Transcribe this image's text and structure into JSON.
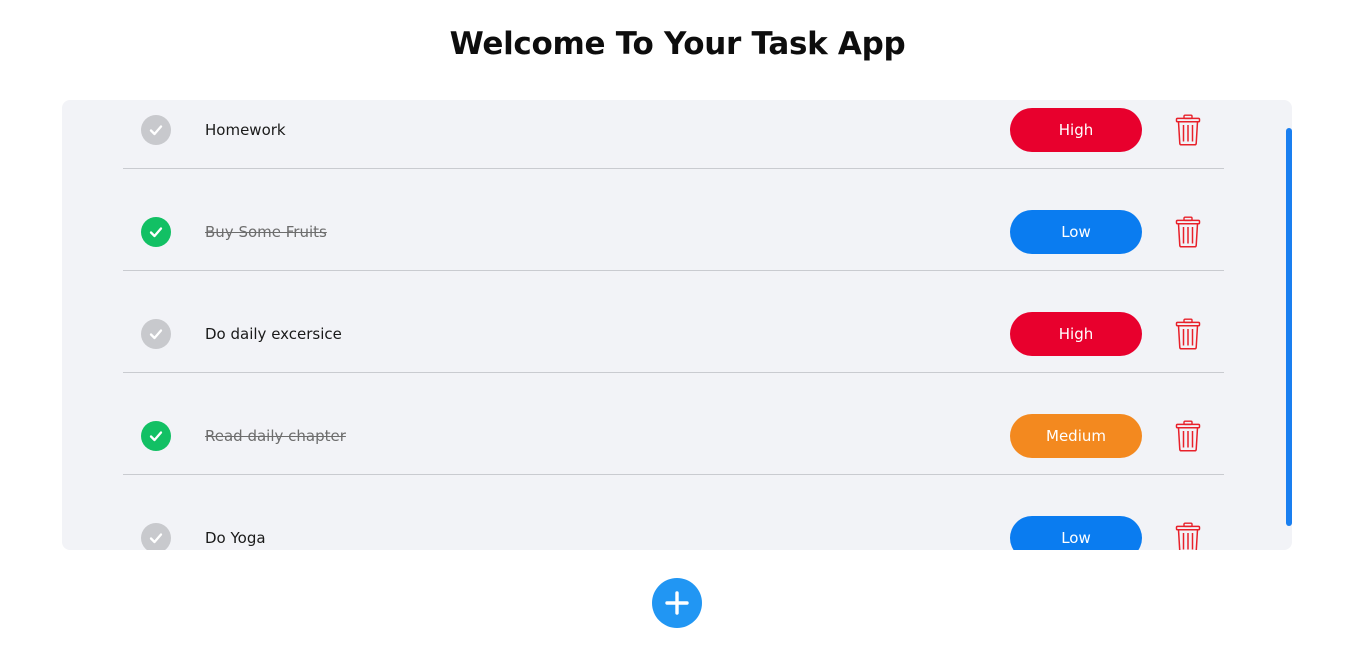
{
  "header": {
    "title": "Welcome To Your Task App"
  },
  "colors": {
    "high": "#e8002d",
    "low": "#0a7cf0",
    "medium": "#f3891f",
    "done": "#12c064",
    "pending": "#c8c9cd",
    "trash": "#e8202a",
    "add": "#2196f3"
  },
  "tasks": [
    {
      "text": "Homework",
      "done": false,
      "priority": "High"
    },
    {
      "text": "Buy Some Fruits",
      "done": true,
      "priority": "Low"
    },
    {
      "text": "Do daily excersice",
      "done": false,
      "priority": "High"
    },
    {
      "text": "Read daily chapter",
      "done": true,
      "priority": "Medium"
    },
    {
      "text": "Do Yoga",
      "done": false,
      "priority": "Low"
    }
  ],
  "icons": {
    "check": "check-icon",
    "trash": "trash-icon",
    "add": "plus-icon"
  }
}
